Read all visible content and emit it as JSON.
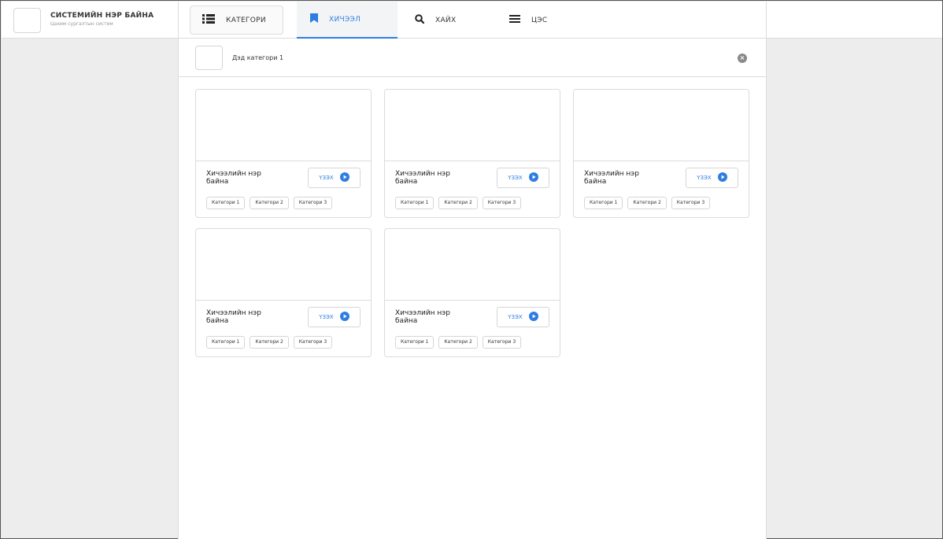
{
  "app": {
    "title": "СИСТЕМИЙН НЭР БАЙНА",
    "subtitle": "Цахим сургалтын систем"
  },
  "nav": {
    "tabs": [
      {
        "label": "КАТЕГОРИ",
        "icon": "list-icon"
      },
      {
        "label": "ХИЧЭЭЛ",
        "icon": "bookmark-icon",
        "active": true
      },
      {
        "label": "ХАЙХ",
        "icon": "search-icon"
      },
      {
        "label": "ЦЭС",
        "icon": "menu-icon"
      }
    ]
  },
  "subcategory": {
    "label": "Дэд категори 1",
    "close_icon": "close-icon"
  },
  "colors": {
    "accent": "#2f7de1",
    "border": "#dcdcdc",
    "background": "#ededed"
  },
  "lessons": [
    {
      "title": "Хичээлийн нэр байна",
      "button": "ҮЗЭХ",
      "tags": [
        "Категори 1",
        "Категори 2",
        "Категори 3"
      ]
    },
    {
      "title": "Хичээлийн нэр байна",
      "button": "ҮЗЭХ",
      "tags": [
        "Категори 1",
        "Категори 2",
        "Категори 3"
      ]
    },
    {
      "title": "Хичээлийн нэр байна",
      "button": "ҮЗЭХ",
      "tags": [
        "Категори 1",
        "Категори 2",
        "Категори 3"
      ]
    },
    {
      "title": "Хичээлийн нэр байна",
      "button": "ҮЗЭХ",
      "tags": [
        "Категори 1",
        "Категори 2",
        "Категори 3"
      ]
    },
    {
      "title": "Хичээлийн нэр байна",
      "button": "ҮЗЭХ",
      "tags": [
        "Категори 1",
        "Категори 2",
        "Категори 3"
      ]
    }
  ]
}
